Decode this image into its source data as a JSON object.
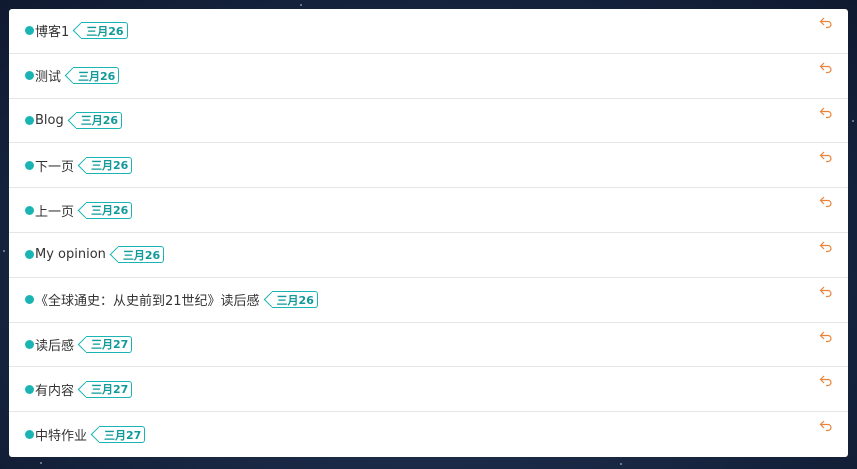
{
  "colors": {
    "accent": "#1ab4b4",
    "reply_icon": "#e8833a"
  },
  "items": [
    {
      "title": "博客1",
      "date": "三月26",
      "icon": "reply-icon"
    },
    {
      "title": "测试",
      "date": "三月26",
      "icon": "reply-icon"
    },
    {
      "title": "Blog",
      "date": "三月26",
      "icon": "reply-icon"
    },
    {
      "title": "下一页",
      "date": "三月26",
      "icon": "reply-icon"
    },
    {
      "title": "上一页",
      "date": "三月26",
      "icon": "reply-icon"
    },
    {
      "title": "My opinion",
      "date": "三月26",
      "icon": "reply-icon"
    },
    {
      "title": "《全球通史：从史前到21世纪》读后感",
      "date": "三月26",
      "icon": "reply-icon"
    },
    {
      "title": "读后感",
      "date": "三月27",
      "icon": "reply-icon"
    },
    {
      "title": "有内容",
      "date": "三月27",
      "icon": "reply-icon"
    },
    {
      "title": "中特作业",
      "date": "三月27",
      "icon": "reply-icon"
    }
  ]
}
